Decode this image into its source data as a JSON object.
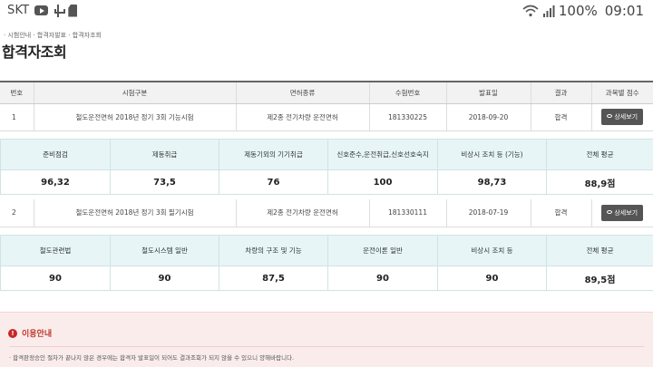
{
  "status_bar": {
    "carrier": "SKT",
    "battery": "100%",
    "time": "09:01",
    "icons": [
      "youtube-icon",
      "usb-icon",
      "sdcard-icon",
      "wifi-icon",
      "signal-icon"
    ]
  },
  "breadcrumb": "· 시험안내 · 합격자발표 · 합격자조회",
  "page_title": "합격자조회",
  "result_table": {
    "headers": [
      "번호",
      "시험구분",
      "면허종류",
      "수험번호",
      "발표일",
      "결과",
      "과목별 점수"
    ],
    "rows": [
      {
        "no": "1",
        "exam": "철도운전면허 2018년 정기 3회 기능시험",
        "license": "제2종 전기차량 운전면허",
        "exam_no": "181330225",
        "date": "2018-09-20",
        "result": "합격",
        "button": "상세보기"
      },
      {
        "no": "2",
        "exam": "철도운전면허 2018년 정기 3회 필기시험",
        "license": "제2종 전기차량 운전면허",
        "exam_no": "181330111",
        "date": "2018-07-19",
        "result": "합격",
        "button": "상세보기"
      }
    ]
  },
  "score_table_1": {
    "headers": [
      "준비점검",
      "제동취급",
      "제동기외의 기기취급",
      "신호준수,운전취급,신호선호숙지",
      "비상시 조치 등 (기능)",
      "전체 평균"
    ],
    "values": [
      "96,32",
      "73,5",
      "76",
      "100",
      "98,73",
      "88,9점"
    ]
  },
  "score_table_2": {
    "headers": [
      "철도관련법",
      "철도시스템 일반",
      "차량의 구조 및 기능",
      "운전이론 일반",
      "비상시 조치 등",
      "전체 평균"
    ],
    "values": [
      "90",
      "90",
      "87,5",
      "90",
      "90",
      "89,5점"
    ]
  },
  "notice": {
    "icon": "!",
    "title": "이용안내",
    "text": "· 합격판정승인 절차가 끝나지 않은 경우에는 합격자 발표일이 되어도 결과조회가 되지 않을 수 있으니 양해바랍니다."
  },
  "colors": {
    "accent_red": "#c62828",
    "score_header_bg": "#e7f5f6",
    "button_bg": "#555555",
    "notice_bg": "#fbecec"
  }
}
